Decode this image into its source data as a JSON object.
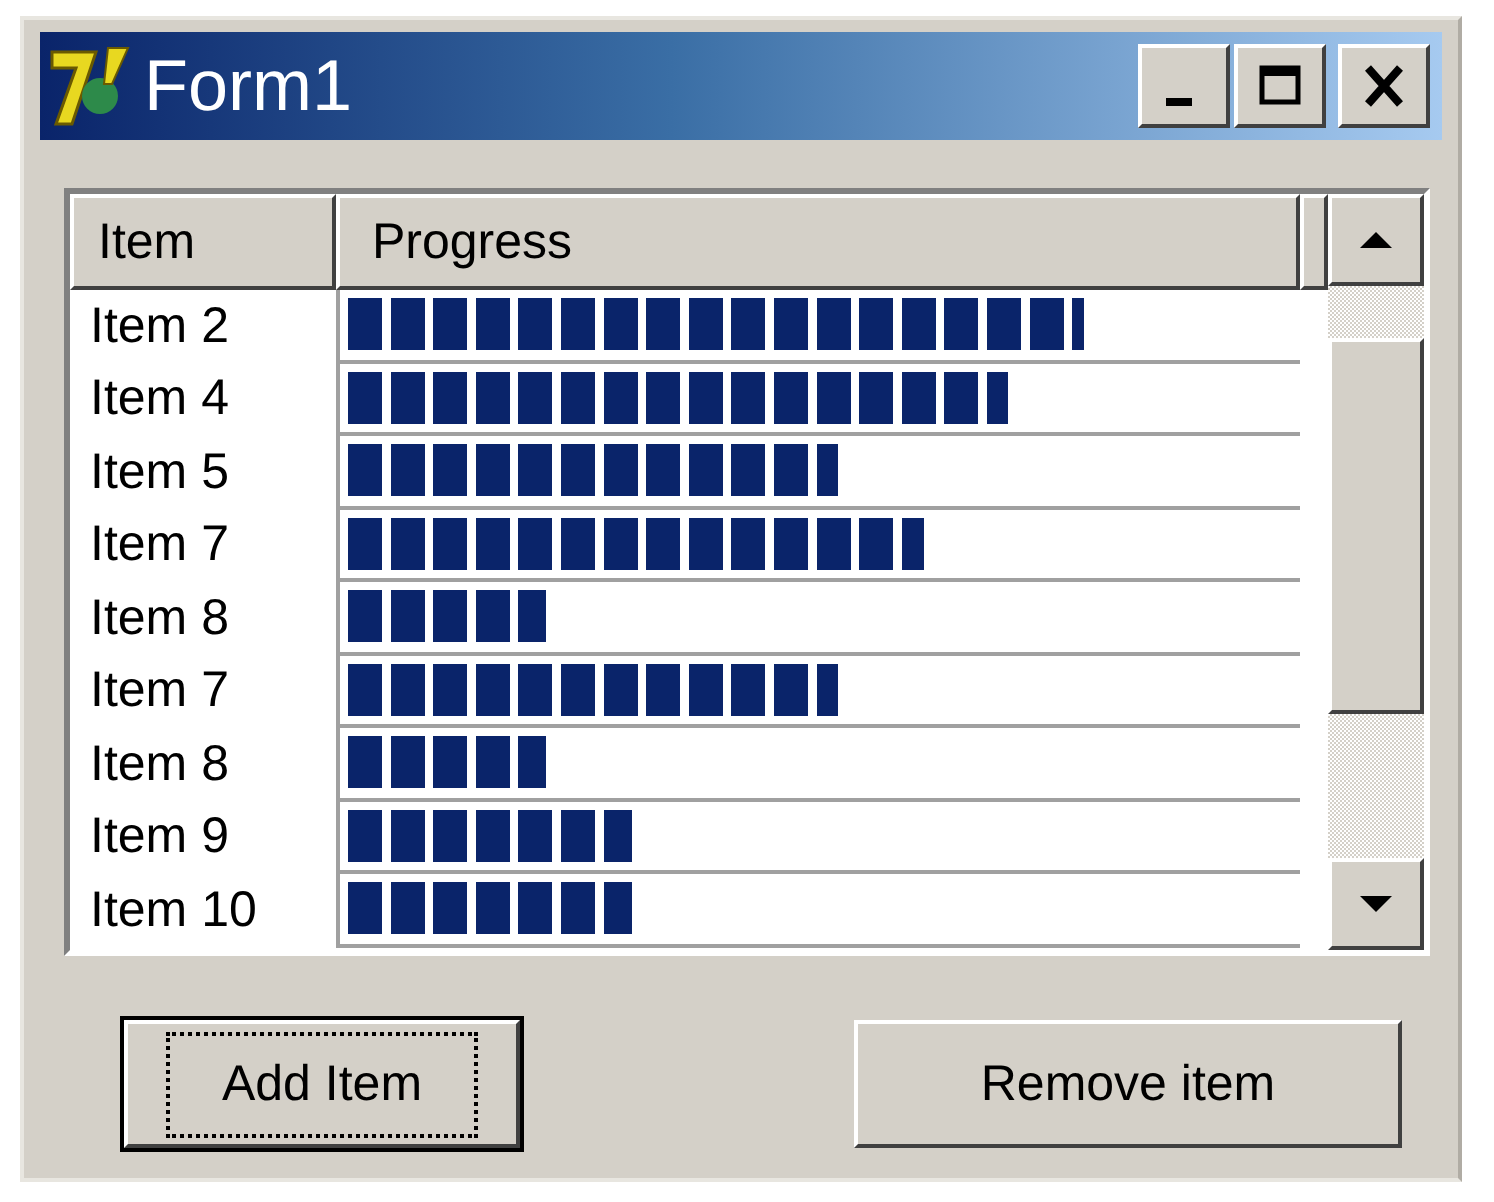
{
  "window": {
    "title": "Form1"
  },
  "list": {
    "columns": [
      "Item",
      "Progress"
    ],
    "rows": [
      {
        "item": "Item 2",
        "level": 0.78
      },
      {
        "item": "Item 4",
        "level": 0.7
      },
      {
        "item": "Item 5",
        "level": 0.52
      },
      {
        "item": "Item 7",
        "level": 0.61
      },
      {
        "item": "Item 8",
        "level": 0.21
      },
      {
        "item": "Item 7",
        "level": 0.52
      },
      {
        "item": "Item 8",
        "level": 0.21
      },
      {
        "item": "Item 9",
        "level": 0.3
      },
      {
        "item": "Item 10",
        "level": 0.3
      }
    ]
  },
  "buttons": [
    {
      "label": "Add Item",
      "focused": true
    },
    {
      "label": "Remove item",
      "focused": false
    }
  ]
}
